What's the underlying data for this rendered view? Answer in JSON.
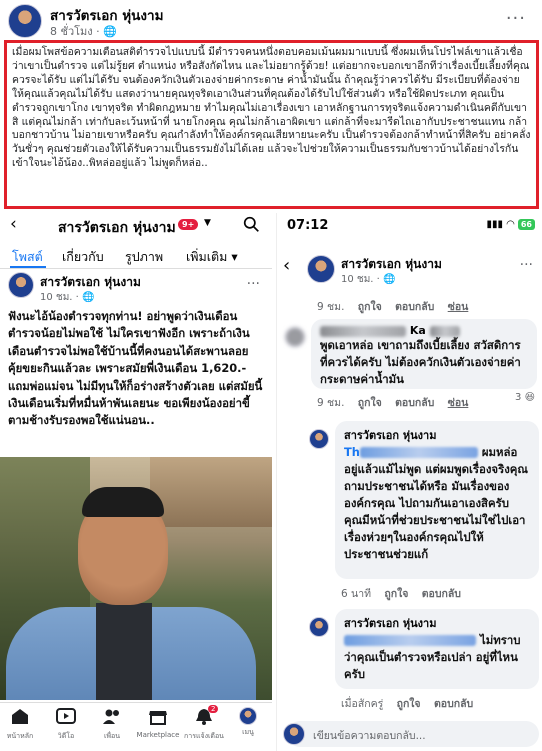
{
  "header": {
    "name": "สารวัตรเอก หุ่นงาม",
    "time": "8 ชั่วโมง · 🌐",
    "more": "···"
  },
  "quote": "เมื่อผมโพสข้อความเตือนสติตำรวจไปแบบนี้ มีตำรวจคนหนึ่งตอบคอมเม้นผมมาแบบนี้ ซึ่งผมเห็นโปรไฟล์เขาแล้วเชื่อว่าเขาเป็นตำรวจ แต่ไม่รู้ยศ ตำแหน่ง หรือสังกัดไหน และไม่อยากรู้ด้วย! แต่อยากจะบอกเขาอีกทีว่าเรื่องเบี้ยเลี้ยงที่คุณควรจะได้รับ แต่ไม่ได้รับ จนต้องควักเงินตัวเองจ่ายค่ากระดาษ ค่าน้ำมันนั้น ถ้าคุณรู้ว่าควรได้รับ มีระเบียบที่ต้องจ่ายให้คุณแล้วคุณไม่ได้รับ แสดงว่านายคุณทุจริตเอาเงินส่วนที่คุณต้องได้รับไปใช้ส่วนตัว หรือใช้ผิดประเภท คุณเป็นตำรวจถูกเขาโกง เขาทุจริต ทำผิดกฎหมาย ทำไมคุณไม่เอาเรื่องเขา เอาหลักฐานการทุจริตแจ้งความดำเนินคดีกับเขาสิ แต่คุณไม่กล้า เท่ากับละเว้นหน้าที่ นายโกงคุณ คุณไม่กล้าเอาผิดเขา แต่กล้าที่จะมารีดไถเอากับประชาชนแทน กล้าบอกชาวบ้าน ไม่อายเขาหรือครับ คุณกำลังทำให้องค์กรคุณเสียหายนะครับ เป็นตำรวจต้องกล้าทำหน้าที่สิครับ อย่าคลั่งวันชั่วๆ คุณช่วยตัวเองให้ได้รับความเป็นธรรมยังไม่ได้เลย แล้วจะไปช่วยให้ความเป็นธรรมกับชาวบ้านได้อย่างไรกัน เข้าใจนะไอ้น้อง..พิหล่ออยู่แล้ว ไม่พูดก็หล่อ..",
  "left": {
    "back": "‹",
    "page_title": "สารวัตรเอก หุ่นงาม",
    "badge": "9+",
    "tabs": [
      "โพสต์",
      "เกี่ยวกับ",
      "รูปภาพ",
      "เพิ่มเติม ▾"
    ],
    "post_name": "สารวัตรเอก หุ่นงาม",
    "post_time": "10 ชม. · 🌐",
    "more": "···",
    "body": "ฟังนะไอ้น้องตำรวจทุกท่าน! อย่าพูดว่าเงินเดือนตำรวจน้อยไม่พอใช้ ไม่ใครเขาฟังอีก เพราะถ้าเงินเดือนตำรวจไม่พอใช้บ้านนี้ที่คงนอนได้สะพานลอย คุ้ยขยะกินแล้วละ เพราะสมัยพี่เงินเดือน 1,620.- แถมพ่อแม่จน ไม่มีทุนให้ก็อร่างสร้างตัวเลย แต่สมัยนี้เงินเดือนเริ่มที่หมื่นห้าพันเลยนะ ขอเพียงน้องอย่าขี้ตามช้างรับรองพอใช้แน่นอน..",
    "nav": [
      "หน้าหลัก",
      "วิดีโอ",
      "เพื่อน",
      "Marketplace",
      "การแจ้งเตือน",
      "เมนู"
    ],
    "nav_badge": "2"
  },
  "right": {
    "clock": "07:12",
    "signal": "▮▮▮ ◠",
    "battery": "66",
    "back": "‹",
    "post_name": "สารวัตรเอก หุ่นงาม",
    "post_time": "10 ชม. · 🌐",
    "more": "···",
    "row1": {
      "time": "9 ชม.",
      "like": "ถูกใจ",
      "reply": "ตอบกลับ",
      "hide": "ซ่อน"
    },
    "c1_name_tail": "Ka",
    "c1_text": "พูดเอาหล่อ เขาถามถึงเบี้ยเลี้ยง สวัสดิการที่ควรได้ครับ ไม่ต้องควักเงินตัวเองจ่ายค่ากระดาษค่าน้ำมัน",
    "row2": {
      "time": "9 ชม.",
      "like": "ถูกใจ",
      "reply": "ตอบกลับ",
      "hide": "ซ่อน",
      "count": "3"
    },
    "c2_name": "สารวัตรเอก หุ่นงาม",
    "c2_head": "Th",
    "c2_text_a": "ผมหล่อ",
    "c2_text": "อยู่แล้วแม้ไม่พูด แต่ผมพูดเรื่องจริงคุณถามประชาชนได้หรือ มันเรื่องขององค์กรคุณ ไปถามกันเอาเองสิครับ คุณมีหน้าที่ช่วยประชาชนไม่ใช่ไปเอาเรื่องห่วยๆในองค์กรคุณไปให้ประชาชนช่วยแก้",
    "row3": {
      "time": "6 นาที",
      "like": "ถูกใจ",
      "reply": "ตอบกลับ"
    },
    "c3_name": "สารวัตรเอก หุ่นงาม",
    "c3_text_a": "ไม่ทราบ",
    "c3_text": "ว่าคุณเป็นตำรวจหรือเปล่า อยู่ที่ไหนครับ",
    "row4": {
      "time": "เมื่อสักครู่",
      "like": "ถูกใจ",
      "reply": "ตอบกลับ"
    },
    "reply_placeholder": "เขียนข้อความตอบกลับ..."
  }
}
